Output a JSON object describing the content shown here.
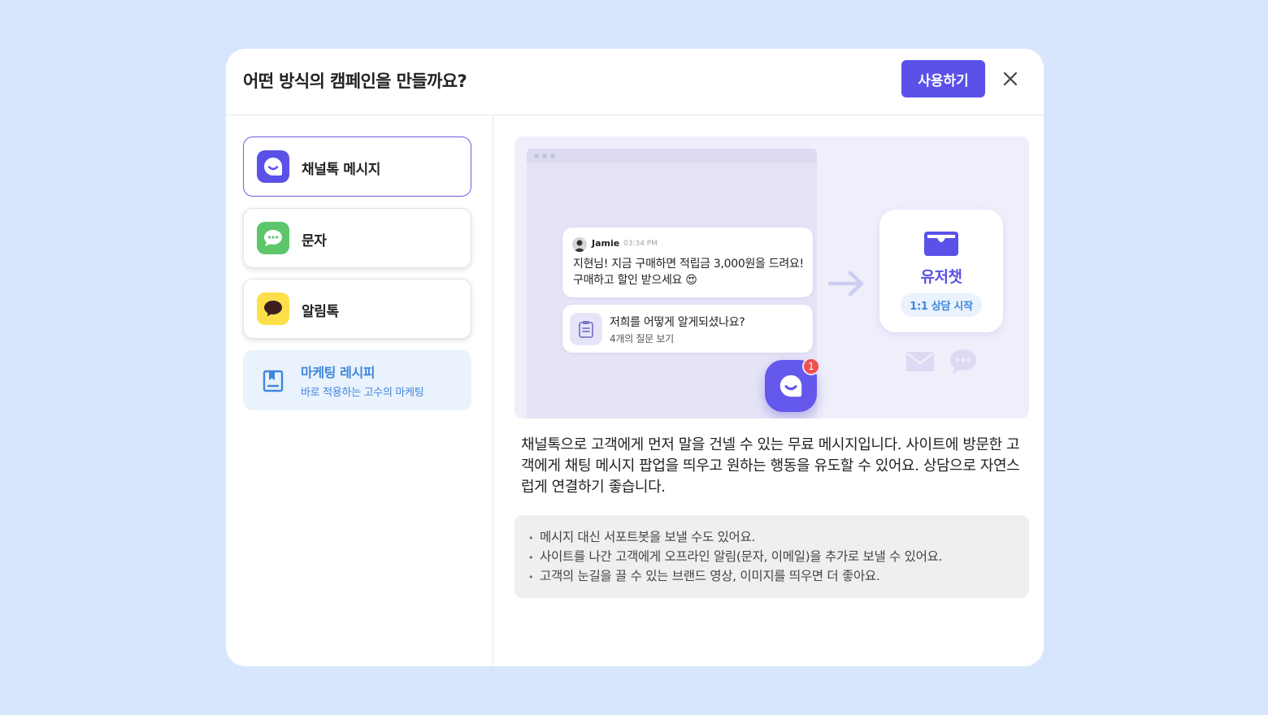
{
  "modal": {
    "title": "어떤 방식의 캠페인을 만들까요?",
    "use_label": "사용하기"
  },
  "options": [
    {
      "label": "채널톡 메시지",
      "selected": true,
      "color": "#5b51e8"
    },
    {
      "label": "문자",
      "selected": false,
      "color": "#5dc66a"
    },
    {
      "label": "알림톡",
      "selected": false,
      "color": "#fbe04a"
    }
  ],
  "recipe": {
    "title": "마케팅 레시피",
    "subtitle": "바로 적용하는 고수의 마케팅"
  },
  "preview": {
    "sender": "Jamie",
    "time": "03:34 PM",
    "message": "지현님! 지금 구매하면 적립금 3,000원을 드려요! 구매하고 할인 받으세요 😍",
    "survey_question": "저희를 어떻게 알게되셨나요?",
    "survey_sub": "4개의 질문 보기",
    "badge_count": "1",
    "userchat_title": "유저챗",
    "userchat_pill": "1:1 상담 시작"
  },
  "description": "채널톡으로 고객에게 먼저 말을 건넬 수 있는 무료 메시지입니다. 사이트에 방문한 고객에게 채팅 메시지 팝업을 띄우고 원하는 행동을 유도할 수 있어요. 상담으로 자연스럽게 연결하기 좋습니다.",
  "tips": [
    "메시지 대신 서포트봇을 보낼 수도 있어요.",
    "사이트를 나간 고객에게 오프라인 알림(문자, 이메일)을 추가로 보낼 수 있어요.",
    "고객의 눈길을 끌 수 있는 브랜드 영상, 이미지를 띄우면 더 좋아요."
  ],
  "colors": {
    "accent": "#5b51e8",
    "page_bg": "#d8e6fd",
    "recipe_text": "#3f86de"
  }
}
